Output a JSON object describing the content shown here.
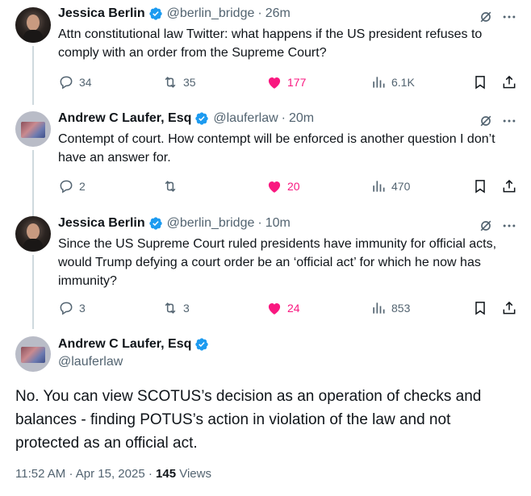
{
  "tweets": [
    {
      "name": "Jessica Berlin",
      "handle": "@berlin_bridge",
      "time": "26m",
      "text": "Attn constitutional law Twitter: what happens if the US president refuses to comply with an order from the Supreme Court?",
      "replies": "34",
      "retweets": "35",
      "likes": "177",
      "views": "6.1K",
      "liked": true
    },
    {
      "name": "Andrew C Laufer, Esq",
      "handle": "@lauferlaw",
      "time": "20m",
      "text": "Contempt of court.  How contempt will be enforced is another question I don’t have an answer for.",
      "replies": "2",
      "retweets": "",
      "likes": "20",
      "views": "470",
      "liked": true
    },
    {
      "name": "Jessica Berlin",
      "handle": "@berlin_bridge",
      "time": "10m",
      "text": "Since the US Supreme Court ruled presidents have immunity for official acts, would Trump defying a court order be an ‘official act’ for which he now has immunity?",
      "replies": "3",
      "retweets": "3",
      "likes": "24",
      "views": "853",
      "liked": true
    }
  ],
  "main": {
    "name": "Andrew C Laufer, Esq",
    "handle": "@lauferlaw",
    "text": "No.  You can view SCOTUS’s decision as an operation of checks and balances - finding POTUS’s action in violation of the law and not protected as an official act.",
    "time": "11:52 AM",
    "sep": "·",
    "date": "Apr 15, 2025",
    "views_count": "145",
    "views_label": "Views"
  },
  "common": {
    "dot": "·"
  },
  "colors": {
    "verified": "#1d9bf0",
    "like": "#f91880",
    "muted": "#536471",
    "line": "#cfd9de"
  }
}
